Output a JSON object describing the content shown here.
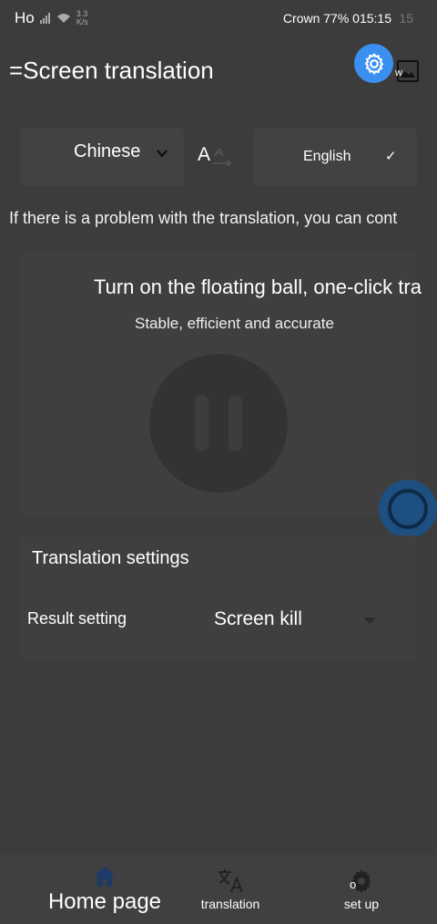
{
  "status_bar": {
    "carrier": "Ho",
    "speed_value": "3.3",
    "speed_unit": "K/s",
    "right_text": "Crown 77% 015:15",
    "ghost_time": "15"
  },
  "header": {
    "title": "=Screen translation",
    "image_icon_letter": "w"
  },
  "languages": {
    "source": "Chinese",
    "target": "English",
    "target_check": "✓",
    "swap_glyph": "A"
  },
  "notice": "If there is a problem with the translation, you can cont",
  "floating_ball": {
    "title": "Turn on the floating ball, one-click tra",
    "subtitle": "Stable, efficient and accurate"
  },
  "settings": {
    "title": "Translation settings",
    "result_label": "Result setting",
    "result_value": "Screen kill"
  },
  "bottom_nav": {
    "home": "Home page",
    "translation": "translation",
    "setup": "set up",
    "setup_overlay": "o"
  },
  "colors": {
    "background": "#3c3c3c",
    "accent": "#3a8ff0",
    "floating_ball": "#1d4f80",
    "nav_active": "#1e3a66"
  },
  "icons": {
    "gear": "gear-icon",
    "image": "image-icon",
    "chevron": "chevron-down-icon",
    "swap": "translate-swap-icon",
    "pause": "pause-icon",
    "home": "home-icon",
    "translate": "translate-icon",
    "settings": "settings-gear-icon"
  }
}
